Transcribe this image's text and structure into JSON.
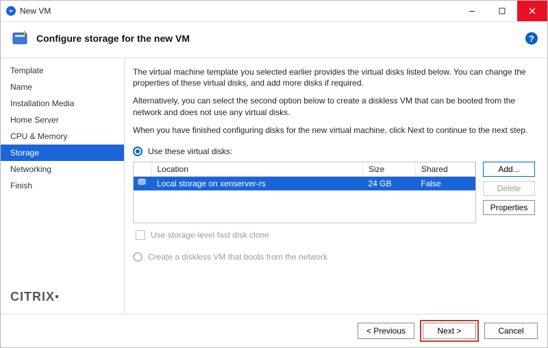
{
  "window": {
    "title": "New VM"
  },
  "header": {
    "title": "Configure storage for the new VM"
  },
  "sidebar": {
    "items": [
      {
        "label": "Template"
      },
      {
        "label": "Name"
      },
      {
        "label": "Installation Media"
      },
      {
        "label": "Home Server"
      },
      {
        "label": "CPU & Memory"
      },
      {
        "label": "Storage"
      },
      {
        "label": "Networking"
      },
      {
        "label": "Finish"
      }
    ],
    "active_index": 5,
    "brand": "CITRIX"
  },
  "main": {
    "paragraphs": [
      "The virtual machine template you selected earlier provides the virtual disks listed below. You can change the properties of these virtual disks, and add more disks if required.",
      "Alternatively, you can select the second option below to create a diskless VM that can be booted from the network and does not use any virtual disks.",
      "When you have finished configuring disks for the new virtual machine, click Next to continue to the next step."
    ],
    "option_use_disks": "Use these virtual disks:",
    "option_diskless": "Create a diskless VM that boots from the network",
    "fast_clone_label": "Use storage-level fast disk clone",
    "table": {
      "headers": {
        "location": "Location",
        "size": "Size",
        "shared": "Shared"
      },
      "rows": [
        {
          "location": "Local storage on xenserver-rs",
          "size": "24 GB",
          "shared": "False"
        }
      ]
    },
    "buttons": {
      "add": "Add...",
      "delete": "Delete",
      "properties": "Properties"
    }
  },
  "footer": {
    "previous": "< Previous",
    "next": "Next >",
    "cancel": "Cancel"
  }
}
